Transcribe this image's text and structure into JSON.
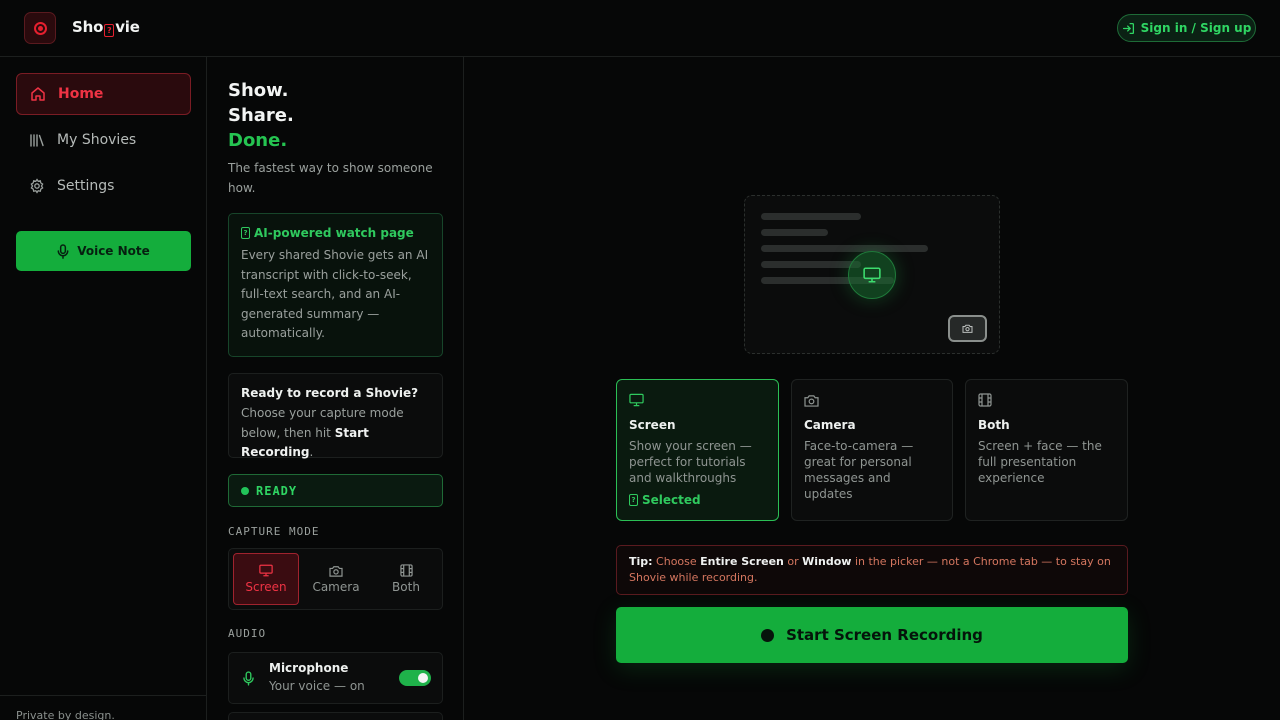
{
  "header": {
    "brand_prefix": "Sho",
    "brand_glyph": "?",
    "brand_suffix": "vie",
    "signin_label": "Sign in / Sign up"
  },
  "nav": {
    "items": [
      {
        "label": "Home",
        "icon": "home-icon",
        "active": true
      },
      {
        "label": "My Shovies",
        "icon": "library-icon",
        "active": false
      },
      {
        "label": "Settings",
        "icon": "gear-icon",
        "active": false
      }
    ],
    "voice_note_label": "Voice Note",
    "footer_text": "Private by design."
  },
  "sidebar": {
    "hero_line1": "Show.",
    "hero_line2": "Share.",
    "hero_line3": "Done.",
    "tagline": "The fastest way to show someone how.",
    "ai_card": {
      "glyph": "?",
      "title": "AI-powered watch page",
      "body": "Every shared Shovie gets an AI transcript with click-to-seek, full-text search, and an AI-generated summary — automatically."
    },
    "ready_card": {
      "title": "Ready to record a Shovie?",
      "body_before": "Choose your capture mode below, then hit ",
      "body_bold": "Start Recording",
      "body_after": "."
    },
    "status_label": "READY",
    "capture_mode_label": "CAPTURE MODE",
    "modes": [
      {
        "label": "Screen",
        "icon": "monitor-icon",
        "selected": true
      },
      {
        "label": "Camera",
        "icon": "camera-icon",
        "selected": false
      },
      {
        "label": "Both",
        "icon": "film-icon",
        "selected": false
      }
    ],
    "audio_label": "AUDIO",
    "microphone": {
      "name": "Microphone",
      "status": "Your voice — on",
      "enabled": true
    }
  },
  "main": {
    "mode_cards": [
      {
        "title": "Screen",
        "desc": "Show your screen — perfect for tutorials and walkthroughs",
        "icon": "monitor-icon",
        "selected": true,
        "selected_label": "Selected",
        "selected_glyph": "?"
      },
      {
        "title": "Camera",
        "desc": "Face-to-camera — great for personal messages and updates",
        "icon": "camera-icon",
        "selected": false
      },
      {
        "title": "Both",
        "desc": "Screen + face — the full presentation experience",
        "icon": "film-icon",
        "selected": false
      }
    ],
    "tip": {
      "label": "Tip:",
      "t1": " Choose ",
      "b1": "Entire Screen",
      "t2": " or ",
      "b2": "Window",
      "t3": " in the picker — not a Chrome tab — to stay on Shovie while recording."
    },
    "start_label": "Start Screen Recording"
  },
  "colors": {
    "accent_green": "#14ad3c",
    "accent_red": "#e6202f",
    "background": "#060707"
  }
}
